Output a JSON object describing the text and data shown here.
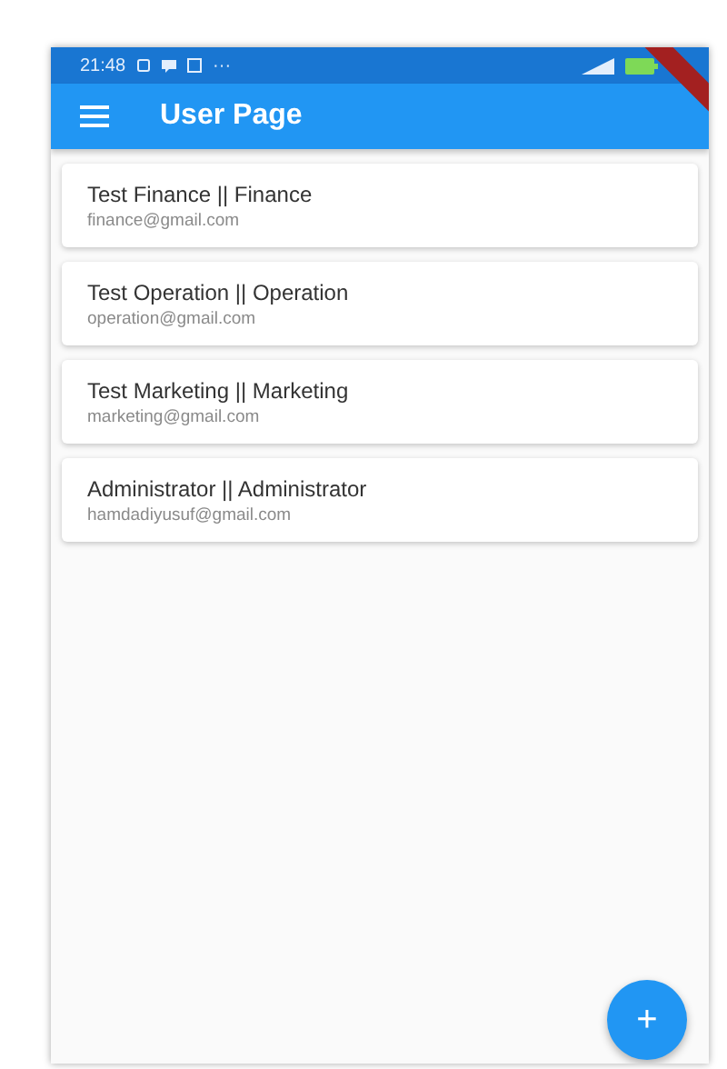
{
  "status_bar": {
    "time": "21:48",
    "dots": "···"
  },
  "app_bar": {
    "title": "User Page"
  },
  "users": [
    {
      "name": "Test Finance || Finance",
      "email": "finance@gmail.com"
    },
    {
      "name": "Test Operation || Operation",
      "email": "operation@gmail.com"
    },
    {
      "name": "Test Marketing || Marketing",
      "email": "marketing@gmail.com"
    },
    {
      "name": "Administrator || Administrator",
      "email": "hamdadiyusuf@gmail.com"
    }
  ],
  "fab": {
    "label": "+"
  }
}
